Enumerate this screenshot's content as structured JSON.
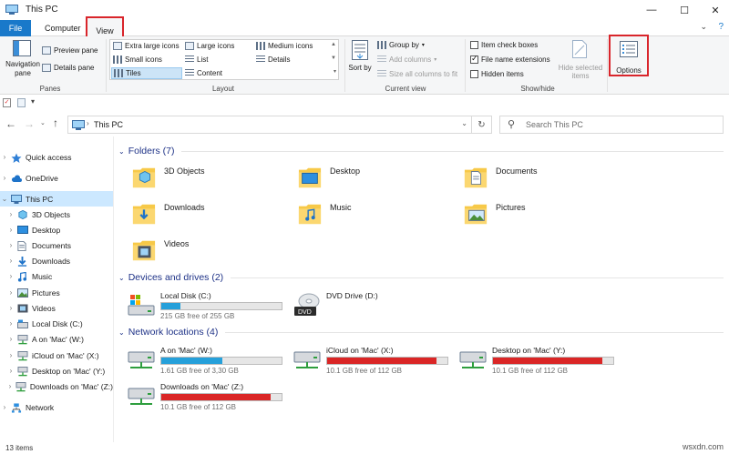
{
  "window": {
    "title": "This PC"
  },
  "tabs": {
    "file": "File",
    "computer": "Computer",
    "view": "View"
  },
  "ribbon": {
    "panes": {
      "navigation_pane": "Navigation pane",
      "preview_pane": "Preview pane",
      "details_pane": "Details pane",
      "label": "Panes"
    },
    "layout": {
      "extra_large_icons": "Extra large icons",
      "large_icons": "Large icons",
      "medium_icons": "Medium icons",
      "small_icons": "Small icons",
      "list": "List",
      "details": "Details",
      "tiles": "Tiles",
      "content": "Content",
      "label": "Layout"
    },
    "current_view": {
      "sort_by": "Sort by",
      "group_by": "Group by",
      "add_columns": "Add columns",
      "size_all_columns": "Size all columns to fit",
      "label": "Current view"
    },
    "show_hide": {
      "item_check_boxes": "Item check boxes",
      "file_name_extensions": "File name extensions",
      "hidden_items": "Hidden items",
      "item_check_boxes_checked": false,
      "file_name_extensions_checked": true,
      "hidden_items_checked": false,
      "hide_selected_items": "Hide selected items",
      "label": "Show/hide"
    },
    "options": "Options"
  },
  "address": {
    "location": "This PC",
    "search_placeholder": "Search This PC"
  },
  "nav": [
    {
      "label": "Quick access",
      "level": 0,
      "icon": "star-icon"
    },
    {
      "label": "OneDrive",
      "level": 0,
      "icon": "cloud-icon"
    },
    {
      "label": "This PC",
      "level": 0,
      "icon": "computer-icon",
      "selected": true
    },
    {
      "label": "3D Objects",
      "level": 1,
      "icon": "cube-icon"
    },
    {
      "label": "Desktop",
      "level": 1,
      "icon": "desktop-icon"
    },
    {
      "label": "Documents",
      "level": 1,
      "icon": "document-icon"
    },
    {
      "label": "Downloads",
      "level": 1,
      "icon": "download-icon"
    },
    {
      "label": "Music",
      "level": 1,
      "icon": "music-icon"
    },
    {
      "label": "Pictures",
      "level": 1,
      "icon": "picture-icon"
    },
    {
      "label": "Videos",
      "level": 1,
      "icon": "video-icon"
    },
    {
      "label": "Local Disk (C:)",
      "level": 1,
      "icon": "disk-icon"
    },
    {
      "label": "A on 'Mac' (W:)",
      "level": 1,
      "icon": "network-drive-icon"
    },
    {
      "label": "iCloud on 'Mac' (X:)",
      "level": 1,
      "icon": "network-drive-icon"
    },
    {
      "label": "Desktop on 'Mac' (Y:)",
      "level": 1,
      "icon": "network-drive-icon"
    },
    {
      "label": "Downloads on 'Mac' (Z:)",
      "level": 1,
      "icon": "network-drive-icon"
    },
    {
      "label": "Network",
      "level": 0,
      "icon": "network-icon"
    }
  ],
  "content": {
    "folders_header": "Folders (7)",
    "folders": [
      {
        "name": "3D Objects",
        "icon": "3d-objects-folder-icon"
      },
      {
        "name": "Desktop",
        "icon": "desktop-folder-icon"
      },
      {
        "name": "Documents",
        "icon": "documents-folder-icon"
      },
      {
        "name": "Downloads",
        "icon": "downloads-folder-icon"
      },
      {
        "name": "Music",
        "icon": "music-folder-icon"
      },
      {
        "name": "Pictures",
        "icon": "pictures-folder-icon"
      },
      {
        "name": "Videos",
        "icon": "videos-folder-icon"
      }
    ],
    "devices_header": "Devices and drives (2)",
    "devices": [
      {
        "name": "Local Disk (C:)",
        "free": "215 GB free of 255 GB",
        "used_fraction": 0.16,
        "color": "#26a0da",
        "kind": "local"
      },
      {
        "name": "DVD Drive (D:)",
        "free": "",
        "used_fraction": null,
        "color": "",
        "kind": "dvd"
      }
    ],
    "network_header": "Network locations (4)",
    "network": [
      {
        "name": "A on 'Mac' (W:)",
        "free": "1.61 GB free of 3,30 GB",
        "used_fraction": 0.51,
        "color": "#26a0da"
      },
      {
        "name": "iCloud on 'Mac' (X:)",
        "free": "10.1 GB free of 112 GB",
        "used_fraction": 0.91,
        "color": "#da2626"
      },
      {
        "name": "Desktop on 'Mac' (Y:)",
        "free": "10.1 GB free of 112 GB",
        "used_fraction": 0.91,
        "color": "#da2626"
      },
      {
        "name": "Downloads on 'Mac' (Z:)",
        "free": "10.1 GB free of 112 GB",
        "used_fraction": 0.91,
        "color": "#da2626"
      }
    ]
  },
  "status": {
    "items": "13 items"
  },
  "watermark": "wsxdn.com"
}
